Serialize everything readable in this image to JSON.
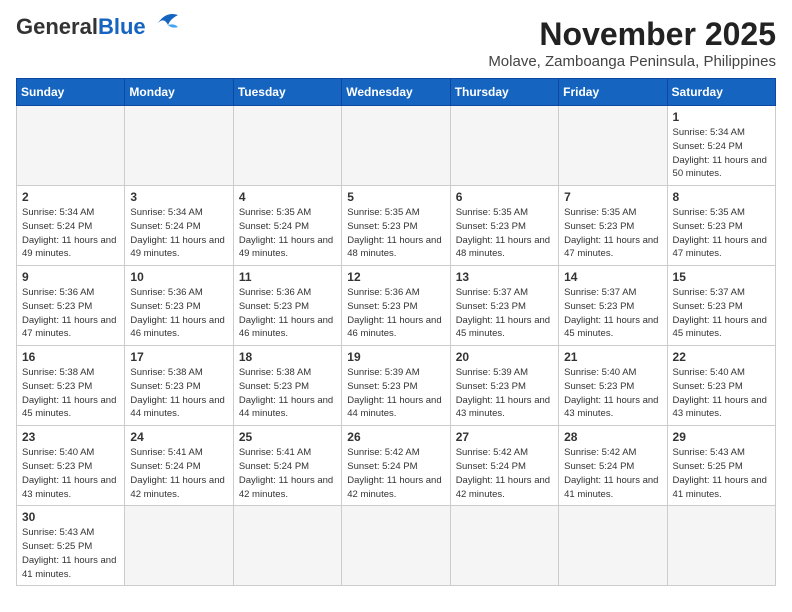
{
  "header": {
    "logo_general": "General",
    "logo_blue": "Blue",
    "month": "November 2025",
    "location": "Molave, Zamboanga Peninsula, Philippines"
  },
  "weekdays": [
    "Sunday",
    "Monday",
    "Tuesday",
    "Wednesday",
    "Thursday",
    "Friday",
    "Saturday"
  ],
  "weeks": [
    [
      {
        "day": "",
        "empty": true
      },
      {
        "day": "",
        "empty": true
      },
      {
        "day": "",
        "empty": true
      },
      {
        "day": "",
        "empty": true
      },
      {
        "day": "",
        "empty": true
      },
      {
        "day": "",
        "empty": true
      },
      {
        "day": "1",
        "sunrise": "5:34 AM",
        "sunset": "5:24 PM",
        "daylight": "11 hours and 50 minutes."
      }
    ],
    [
      {
        "day": "2",
        "sunrise": "5:34 AM",
        "sunset": "5:24 PM",
        "daylight": "11 hours and 49 minutes."
      },
      {
        "day": "3",
        "sunrise": "5:34 AM",
        "sunset": "5:24 PM",
        "daylight": "11 hours and 49 minutes."
      },
      {
        "day": "4",
        "sunrise": "5:35 AM",
        "sunset": "5:24 PM",
        "daylight": "11 hours and 49 minutes."
      },
      {
        "day": "5",
        "sunrise": "5:35 AM",
        "sunset": "5:23 PM",
        "daylight": "11 hours and 48 minutes."
      },
      {
        "day": "6",
        "sunrise": "5:35 AM",
        "sunset": "5:23 PM",
        "daylight": "11 hours and 48 minutes."
      },
      {
        "day": "7",
        "sunrise": "5:35 AM",
        "sunset": "5:23 PM",
        "daylight": "11 hours and 47 minutes."
      },
      {
        "day": "8",
        "sunrise": "5:35 AM",
        "sunset": "5:23 PM",
        "daylight": "11 hours and 47 minutes."
      }
    ],
    [
      {
        "day": "9",
        "sunrise": "5:36 AM",
        "sunset": "5:23 PM",
        "daylight": "11 hours and 47 minutes."
      },
      {
        "day": "10",
        "sunrise": "5:36 AM",
        "sunset": "5:23 PM",
        "daylight": "11 hours and 46 minutes."
      },
      {
        "day": "11",
        "sunrise": "5:36 AM",
        "sunset": "5:23 PM",
        "daylight": "11 hours and 46 minutes."
      },
      {
        "day": "12",
        "sunrise": "5:36 AM",
        "sunset": "5:23 PM",
        "daylight": "11 hours and 46 minutes."
      },
      {
        "day": "13",
        "sunrise": "5:37 AM",
        "sunset": "5:23 PM",
        "daylight": "11 hours and 45 minutes."
      },
      {
        "day": "14",
        "sunrise": "5:37 AM",
        "sunset": "5:23 PM",
        "daylight": "11 hours and 45 minutes."
      },
      {
        "day": "15",
        "sunrise": "5:37 AM",
        "sunset": "5:23 PM",
        "daylight": "11 hours and 45 minutes."
      }
    ],
    [
      {
        "day": "16",
        "sunrise": "5:38 AM",
        "sunset": "5:23 PM",
        "daylight": "11 hours and 45 minutes."
      },
      {
        "day": "17",
        "sunrise": "5:38 AM",
        "sunset": "5:23 PM",
        "daylight": "11 hours and 44 minutes."
      },
      {
        "day": "18",
        "sunrise": "5:38 AM",
        "sunset": "5:23 PM",
        "daylight": "11 hours and 44 minutes."
      },
      {
        "day": "19",
        "sunrise": "5:39 AM",
        "sunset": "5:23 PM",
        "daylight": "11 hours and 44 minutes."
      },
      {
        "day": "20",
        "sunrise": "5:39 AM",
        "sunset": "5:23 PM",
        "daylight": "11 hours and 43 minutes."
      },
      {
        "day": "21",
        "sunrise": "5:40 AM",
        "sunset": "5:23 PM",
        "daylight": "11 hours and 43 minutes."
      },
      {
        "day": "22",
        "sunrise": "5:40 AM",
        "sunset": "5:23 PM",
        "daylight": "11 hours and 43 minutes."
      }
    ],
    [
      {
        "day": "23",
        "sunrise": "5:40 AM",
        "sunset": "5:23 PM",
        "daylight": "11 hours and 43 minutes."
      },
      {
        "day": "24",
        "sunrise": "5:41 AM",
        "sunset": "5:24 PM",
        "daylight": "11 hours and 42 minutes."
      },
      {
        "day": "25",
        "sunrise": "5:41 AM",
        "sunset": "5:24 PM",
        "daylight": "11 hours and 42 minutes."
      },
      {
        "day": "26",
        "sunrise": "5:42 AM",
        "sunset": "5:24 PM",
        "daylight": "11 hours and 42 minutes."
      },
      {
        "day": "27",
        "sunrise": "5:42 AM",
        "sunset": "5:24 PM",
        "daylight": "11 hours and 42 minutes."
      },
      {
        "day": "28",
        "sunrise": "5:42 AM",
        "sunset": "5:24 PM",
        "daylight": "11 hours and 41 minutes."
      },
      {
        "day": "29",
        "sunrise": "5:43 AM",
        "sunset": "5:25 PM",
        "daylight": "11 hours and 41 minutes."
      }
    ],
    [
      {
        "day": "30",
        "sunrise": "5:43 AM",
        "sunset": "5:25 PM",
        "daylight": "11 hours and 41 minutes."
      },
      {
        "day": "",
        "empty": true
      },
      {
        "day": "",
        "empty": true
      },
      {
        "day": "",
        "empty": true
      },
      {
        "day": "",
        "empty": true
      },
      {
        "day": "",
        "empty": true
      },
      {
        "day": "",
        "empty": true
      }
    ]
  ]
}
